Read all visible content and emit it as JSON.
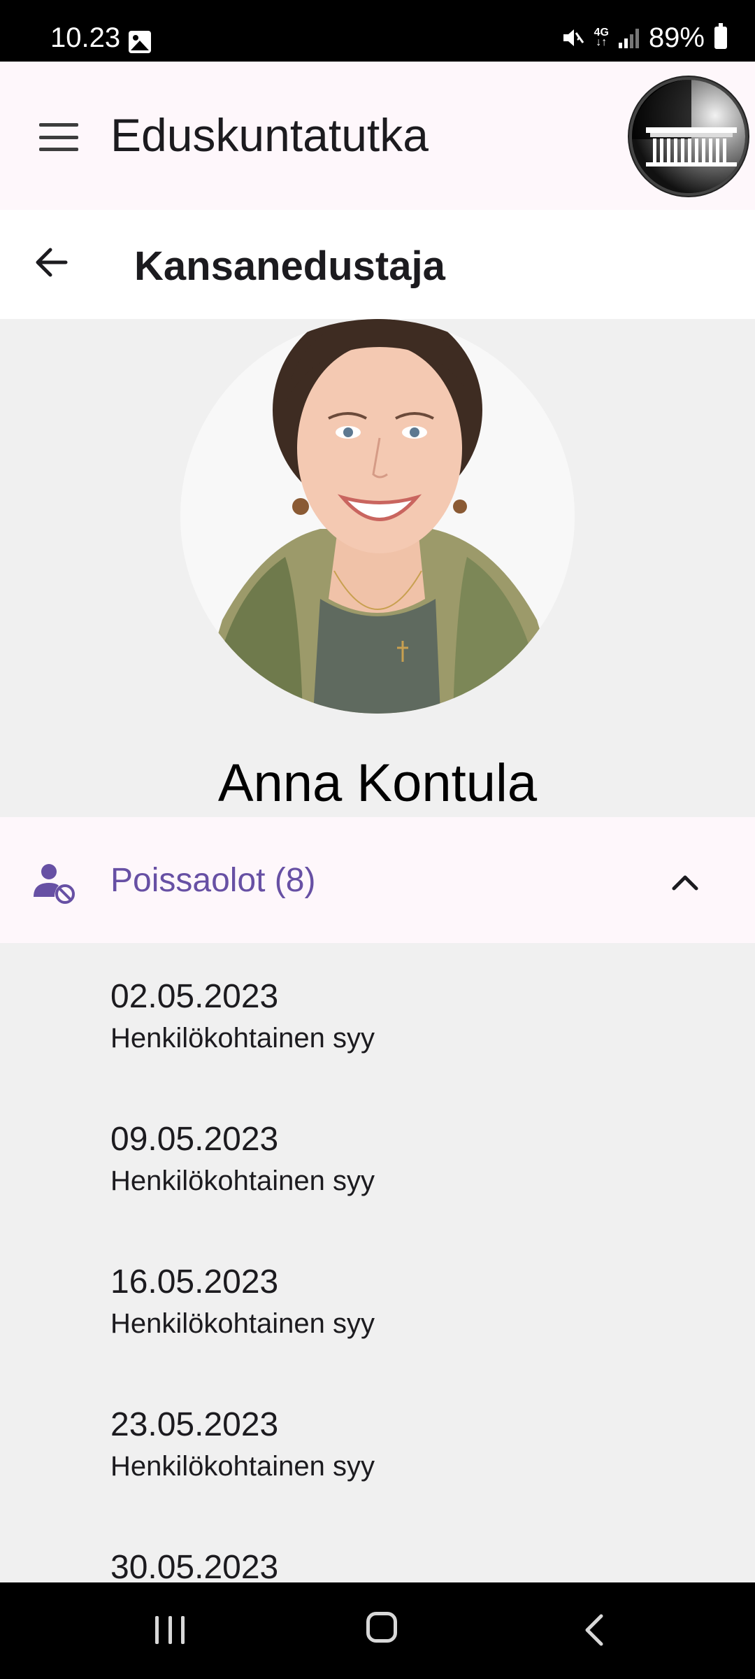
{
  "status_bar": {
    "time": "10.23",
    "battery": "89%",
    "network": "4G",
    "icons": [
      "gallery-icon",
      "mute-icon",
      "network-4g-icon",
      "signal-icon",
      "battery-icon"
    ]
  },
  "app_bar": {
    "title": "Eduskuntatutka",
    "menu_icon": "hamburger-menu-icon",
    "logo": "parliament-building-logo"
  },
  "sub_bar": {
    "title": "Kansanedustaja",
    "back_icon": "back-arrow-icon"
  },
  "profile": {
    "name": "Anna Kontula",
    "photo": "profile-photo"
  },
  "absences": {
    "title": "Poissaolot (8)",
    "icon": "person-absent-icon",
    "expanded": true,
    "items": [
      {
        "date": "02.05.2023",
        "reason": "Henkilökohtainen syy"
      },
      {
        "date": "09.05.2023",
        "reason": "Henkilökohtainen syy"
      },
      {
        "date": "16.05.2023",
        "reason": "Henkilökohtainen syy"
      },
      {
        "date": "23.05.2023",
        "reason": "Henkilökohtainen syy"
      },
      {
        "date": "30.05.2023",
        "reason": ""
      }
    ]
  },
  "nav_bar": {
    "icons": [
      "recent-apps-icon",
      "home-icon",
      "back-icon"
    ]
  },
  "colors": {
    "accent": "#6750a4",
    "top_bar_bg": "#fef7fb",
    "content_bg": "#f0f0f0",
    "system_bar_bg": "#000000"
  }
}
